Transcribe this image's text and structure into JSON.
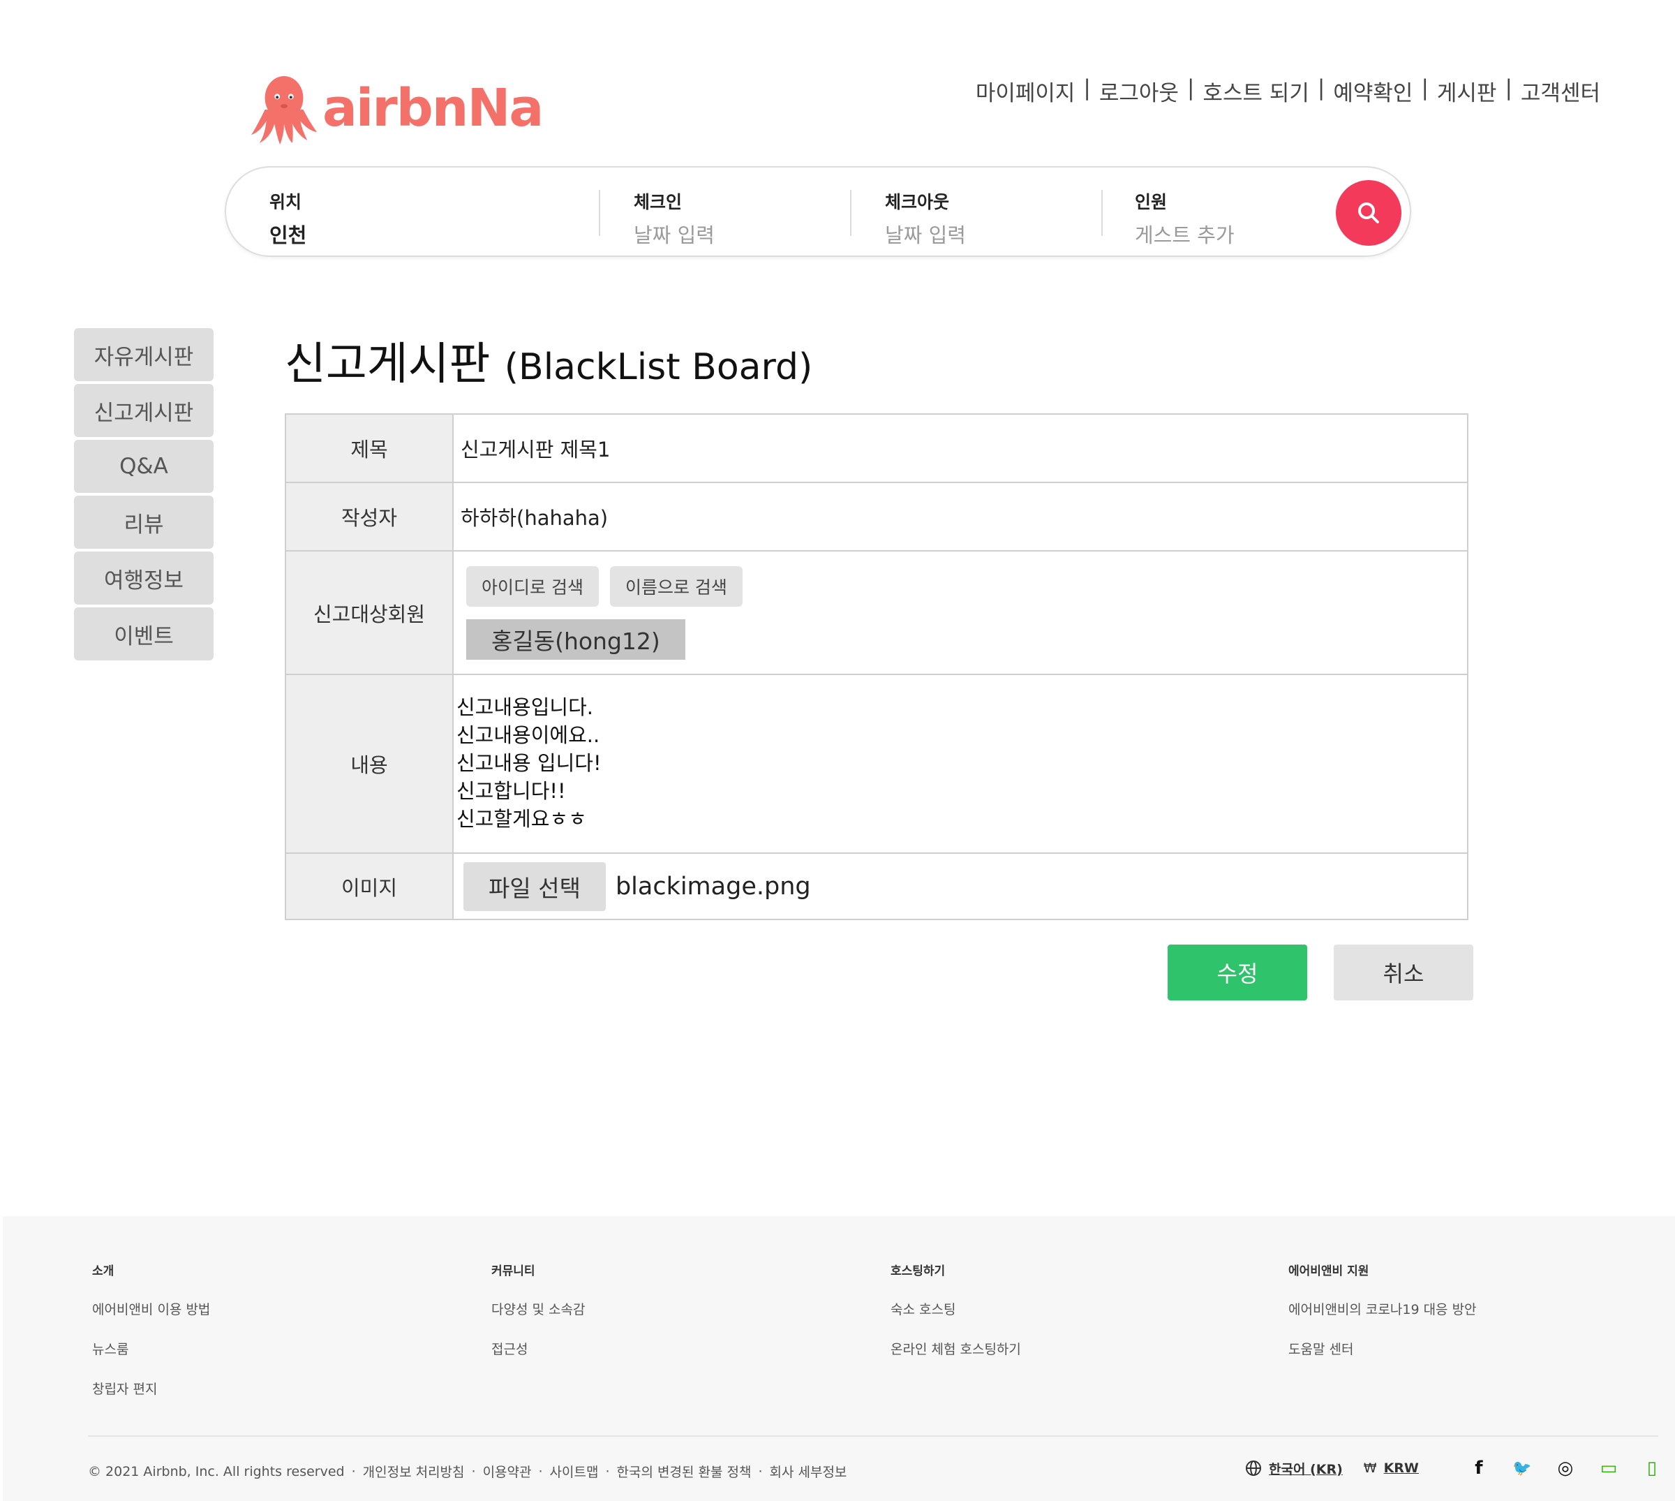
{
  "header": {
    "logo_text": "airbnNa",
    "nav": [
      "마이페이지",
      "로그아웃",
      "호스트 되기",
      "예약확인",
      "게시판",
      "고객센터"
    ],
    "separator": "|"
  },
  "search": {
    "location": {
      "label": "위치",
      "value": "인천"
    },
    "checkin": {
      "label": "체크인",
      "placeholder": "날짜 입력"
    },
    "checkout": {
      "label": "체크아웃",
      "placeholder": "날짜 입력"
    },
    "guests": {
      "label": "인원",
      "placeholder": "게스트 추가"
    },
    "button_color": "#f33a5a"
  },
  "sidebar": {
    "items": [
      {
        "label": "자유게시판"
      },
      {
        "label": "신고게시판"
      },
      {
        "label": "Q&A"
      },
      {
        "label": "리뷰"
      },
      {
        "label": "여행정보"
      },
      {
        "label": "이벤트"
      }
    ]
  },
  "page": {
    "title": "신고게시판",
    "subtitle": "(BlackList Board)"
  },
  "form": {
    "title": {
      "label": "제목",
      "value": "신고게시판 제목1"
    },
    "author": {
      "label": "작성자",
      "value": "하하하(hahaha)"
    },
    "target": {
      "label": "신고대상회원",
      "search_by_id": "아이디로 검색",
      "search_by_name": "이름으로 검색",
      "selected": "홍길동(hong12)"
    },
    "content": {
      "label": "내용",
      "lines": [
        "신고내용입니다.",
        "신고내용이에요..",
        "신고내용 입니다!",
        "신고합니다!!",
        "신고할게요ㅎㅎ"
      ]
    },
    "image": {
      "label": "이미지",
      "button": "파일 선택",
      "filename": "blackimage.png"
    }
  },
  "actions": {
    "edit": "수정",
    "cancel": "취소",
    "edit_color": "#2fc36b"
  },
  "footer": {
    "columns": [
      {
        "heading": "소개",
        "links": [
          "에어비앤비 이용 방법",
          "뉴스룸",
          "창립자 편지"
        ]
      },
      {
        "heading": "커뮤니티",
        "links": [
          "다양성 및 소속감",
          "접근성"
        ]
      },
      {
        "heading": "호스팅하기",
        "links": [
          "숙소 호스팅",
          "온라인 체험 호스팅하기"
        ]
      },
      {
        "heading": "에어비앤비 지원",
        "links": [
          "에어비앤비의 코로나19 대응 방안",
          "도움말 센터"
        ]
      }
    ],
    "legal": [
      "© 2021 Airbnb, Inc. All rights reserved",
      "개인정보 처리방침",
      "이용약관",
      "사이트맵",
      "한국의 변경된 환불 정책",
      "회사 세부정보"
    ],
    "legal_separator": "·",
    "language": "한국어 (KR)",
    "currency_symbol": "₩",
    "currency": "KRW",
    "social": [
      {
        "icon": "facebook-icon",
        "glyph": "f"
      },
      {
        "icon": "twitter-icon",
        "glyph": "🐦"
      },
      {
        "icon": "instagram-icon",
        "glyph": "◎"
      },
      {
        "icon": "naver-blog-icon",
        "glyph": "▭"
      },
      {
        "icon": "naver-post-icon",
        "glyph": "▯"
      }
    ]
  }
}
